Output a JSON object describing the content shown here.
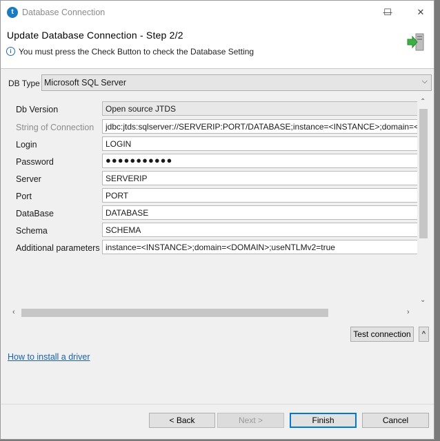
{
  "window": {
    "title": "Database Connection",
    "icon_glyph": "t",
    "controls": {
      "minimize": "—",
      "maximize": "☐",
      "close": "✕"
    }
  },
  "header": {
    "step_title": "Update Database Connection - Step 2/2",
    "info_glyph": "i",
    "info_message": "You must press the Check Button to check the Database Setting"
  },
  "db_type": {
    "label": "DB Type",
    "value": "Microsoft SQL Server",
    "arrow": "⌵"
  },
  "form": {
    "rows": [
      {
        "label": "Db Version",
        "value": "Open source JTDS"
      },
      {
        "label": "String of Connection",
        "value": "jdbc:jtds:sqlserver://SERVERIP:PORT/DATABASE;instance=<INSTANCE>;domain=<DOMAIN>"
      },
      {
        "label": "Login",
        "value": "LOGIN"
      },
      {
        "label": "Password",
        "value": "●●●●●●●●●●●"
      },
      {
        "label": "Server",
        "value": "SERVERIP"
      },
      {
        "label": "Port",
        "value": "PORT"
      },
      {
        "label": "DataBase",
        "value": "DATABASE"
      },
      {
        "label": "Schema",
        "value": "SCHEMA"
      },
      {
        "label": "Additional parameters",
        "value": "instance=<INSTANCE>;domain=<DOMAIN>;useNTLMv2=true"
      }
    ]
  },
  "scroll": {
    "up": "⌃",
    "down": "⌄",
    "left": "‹",
    "right": "›"
  },
  "actions": {
    "test_connection": "Test connection",
    "collapse": "^",
    "driver_link": "How to install a driver"
  },
  "footer": {
    "back": "< Back",
    "next": "Next >",
    "finish": "Finish",
    "cancel": "Cancel"
  },
  "colors": {
    "link": "#1a5fb4",
    "default_button_border": "#0078d7",
    "db_icon_green": "#3cb043"
  }
}
